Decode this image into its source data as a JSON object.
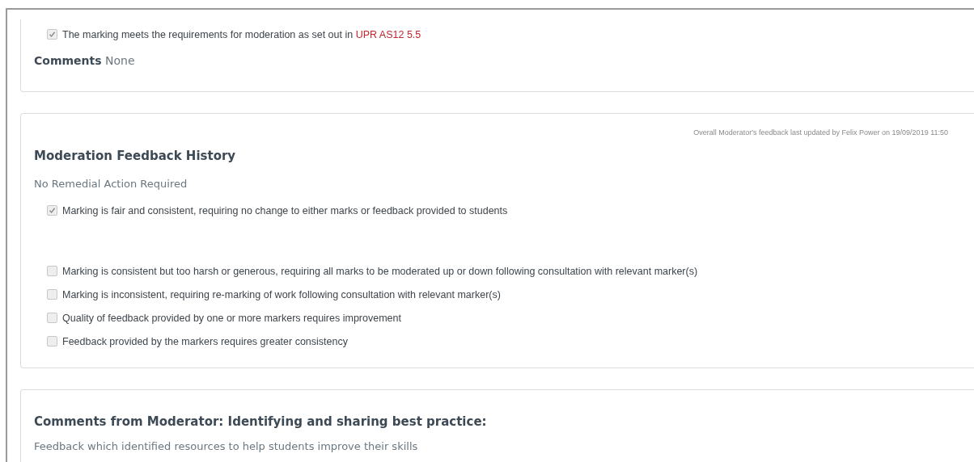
{
  "moderation_check": {
    "criteria": [
      {
        "label": "The marking meets the requirements for moderation as set out in ",
        "link": "UPR AS12 5.5",
        "checked": true
      }
    ],
    "comments_label": "Comments",
    "comments_value": "None"
  },
  "feedback_history": {
    "last_updated": "Overall Moderator's feedback last updated by Felix Power on 19/09/2019 11:50",
    "title": "Moderation Feedback History",
    "outcome": "No Remedial Action Required",
    "options": [
      {
        "label": "Marking is fair and consistent, requiring no change to either marks or feedback provided to students",
        "checked": true
      },
      {
        "label": "Marking is consistent but too harsh or generous, requiring all marks to be moderated up or down following consultation with relevant marker(s)",
        "checked": false
      },
      {
        "label": "Marking is inconsistent, requiring re-marking of work following consultation with relevant marker(s)",
        "checked": false
      },
      {
        "label": "Quality of feedback provided by one or more markers requires improvement",
        "checked": false
      },
      {
        "label": "Feedback provided by the markers requires greater consistency",
        "checked": false
      }
    ]
  },
  "best_practice": {
    "title": "Comments from Moderator: Identifying and sharing best practice:",
    "text": "Feedback which identified resources to help students improve their skills"
  }
}
